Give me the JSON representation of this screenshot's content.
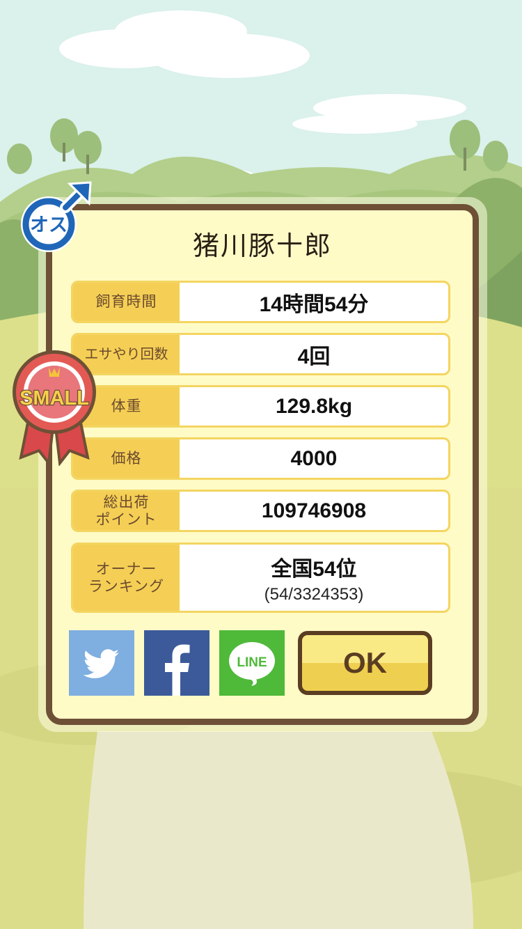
{
  "pig": {
    "name": "猪川豚十郎",
    "gender_badge": "オス",
    "size_ribbon": "SMALL"
  },
  "stats": [
    {
      "label": "飼育時間",
      "value": "14時間54分"
    },
    {
      "label": "エサやり回数",
      "value": "4回"
    },
    {
      "label": "体重",
      "value": "129.8kg"
    },
    {
      "label": "価格",
      "value": "4000"
    },
    {
      "label": "総出荷\nポイント",
      "value": "109746908"
    },
    {
      "label": "オーナー\nランキング",
      "value": "全国54位",
      "sub": "(54/3324353)"
    }
  ],
  "share": {
    "twitter_icon": "twitter-bird-icon",
    "facebook_icon": "facebook-f-icon",
    "line_icon": "line-icon",
    "line_text": "LINE"
  },
  "ok_label": "OK",
  "colors": {
    "card_bg": "#fffbc7",
    "card_border": "#6e5036",
    "label_bg": "#f5cf55",
    "row_border": "#f3d561",
    "twitter": "#7faee0",
    "facebook": "#3c5a9a",
    "line": "#4fb93a",
    "gender_blue": "#1f66b8",
    "ribbon_red": "#d9484a"
  }
}
